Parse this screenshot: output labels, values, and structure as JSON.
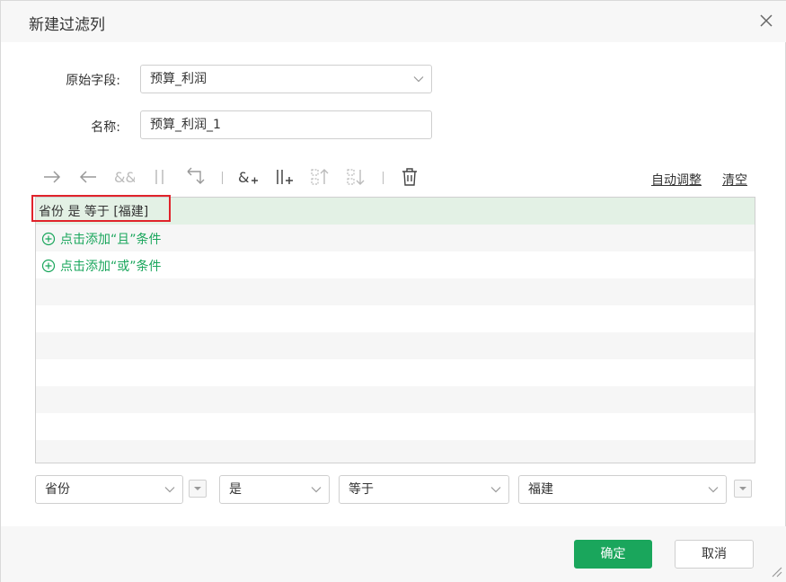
{
  "dialog": {
    "title": "新建过滤列"
  },
  "form": {
    "source_field_label": "原始字段:",
    "source_field_value": "预算_利润",
    "name_label": "名称:",
    "name_value": "预算_利润_1"
  },
  "toolbar": {
    "icons": [
      "arrow-right-icon",
      "arrow-left-icon",
      "and-icon",
      "or-icon",
      "undo-return-icon",
      "add-and-icon",
      "add-or-icon",
      "move-up-icon",
      "move-down-icon",
      "delete-icon"
    ],
    "auto_adjust": "自动调整",
    "clear": "清空"
  },
  "conditions": {
    "rows": [
      "省份 是 等于 [福建]"
    ],
    "add_and": "点击添加“且”条件",
    "add_or": "点击添加“或”条件"
  },
  "editor": {
    "field": "省份",
    "operator_is": "是",
    "comparison": "等于",
    "value": "福建"
  },
  "footer": {
    "ok": "确定",
    "cancel": "取消"
  },
  "colors": {
    "accent": "#1aa65c",
    "selected_row": "#e3f1e5",
    "highlight_border": "#e0232b"
  }
}
